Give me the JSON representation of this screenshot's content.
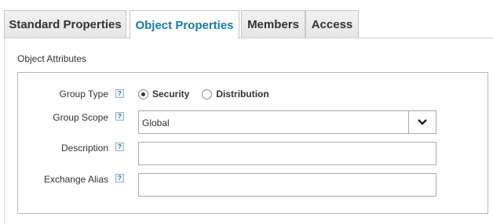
{
  "tabs": [
    {
      "label": "Standard Properties",
      "active": false
    },
    {
      "label": "Object Properties",
      "active": true
    },
    {
      "label": "Members",
      "active": false
    },
    {
      "label": "Access",
      "active": false
    }
  ],
  "section": {
    "title": "Object Attributes"
  },
  "fields": {
    "group_type": {
      "label": "Group Type",
      "help": "?",
      "options": [
        "Security",
        "Distribution"
      ],
      "selected": "Security"
    },
    "group_scope": {
      "label": "Group Scope",
      "help": "?",
      "value": "Global",
      "dropdown_icon": "chevron-down-icon"
    },
    "description": {
      "label": "Description",
      "help": "?",
      "value": ""
    },
    "exchange_alias": {
      "label": "Exchange Alias",
      "help": "?",
      "value": ""
    }
  },
  "colors": {
    "active_tab_text": "#1a7aa0",
    "border": "#aaaaaa"
  }
}
